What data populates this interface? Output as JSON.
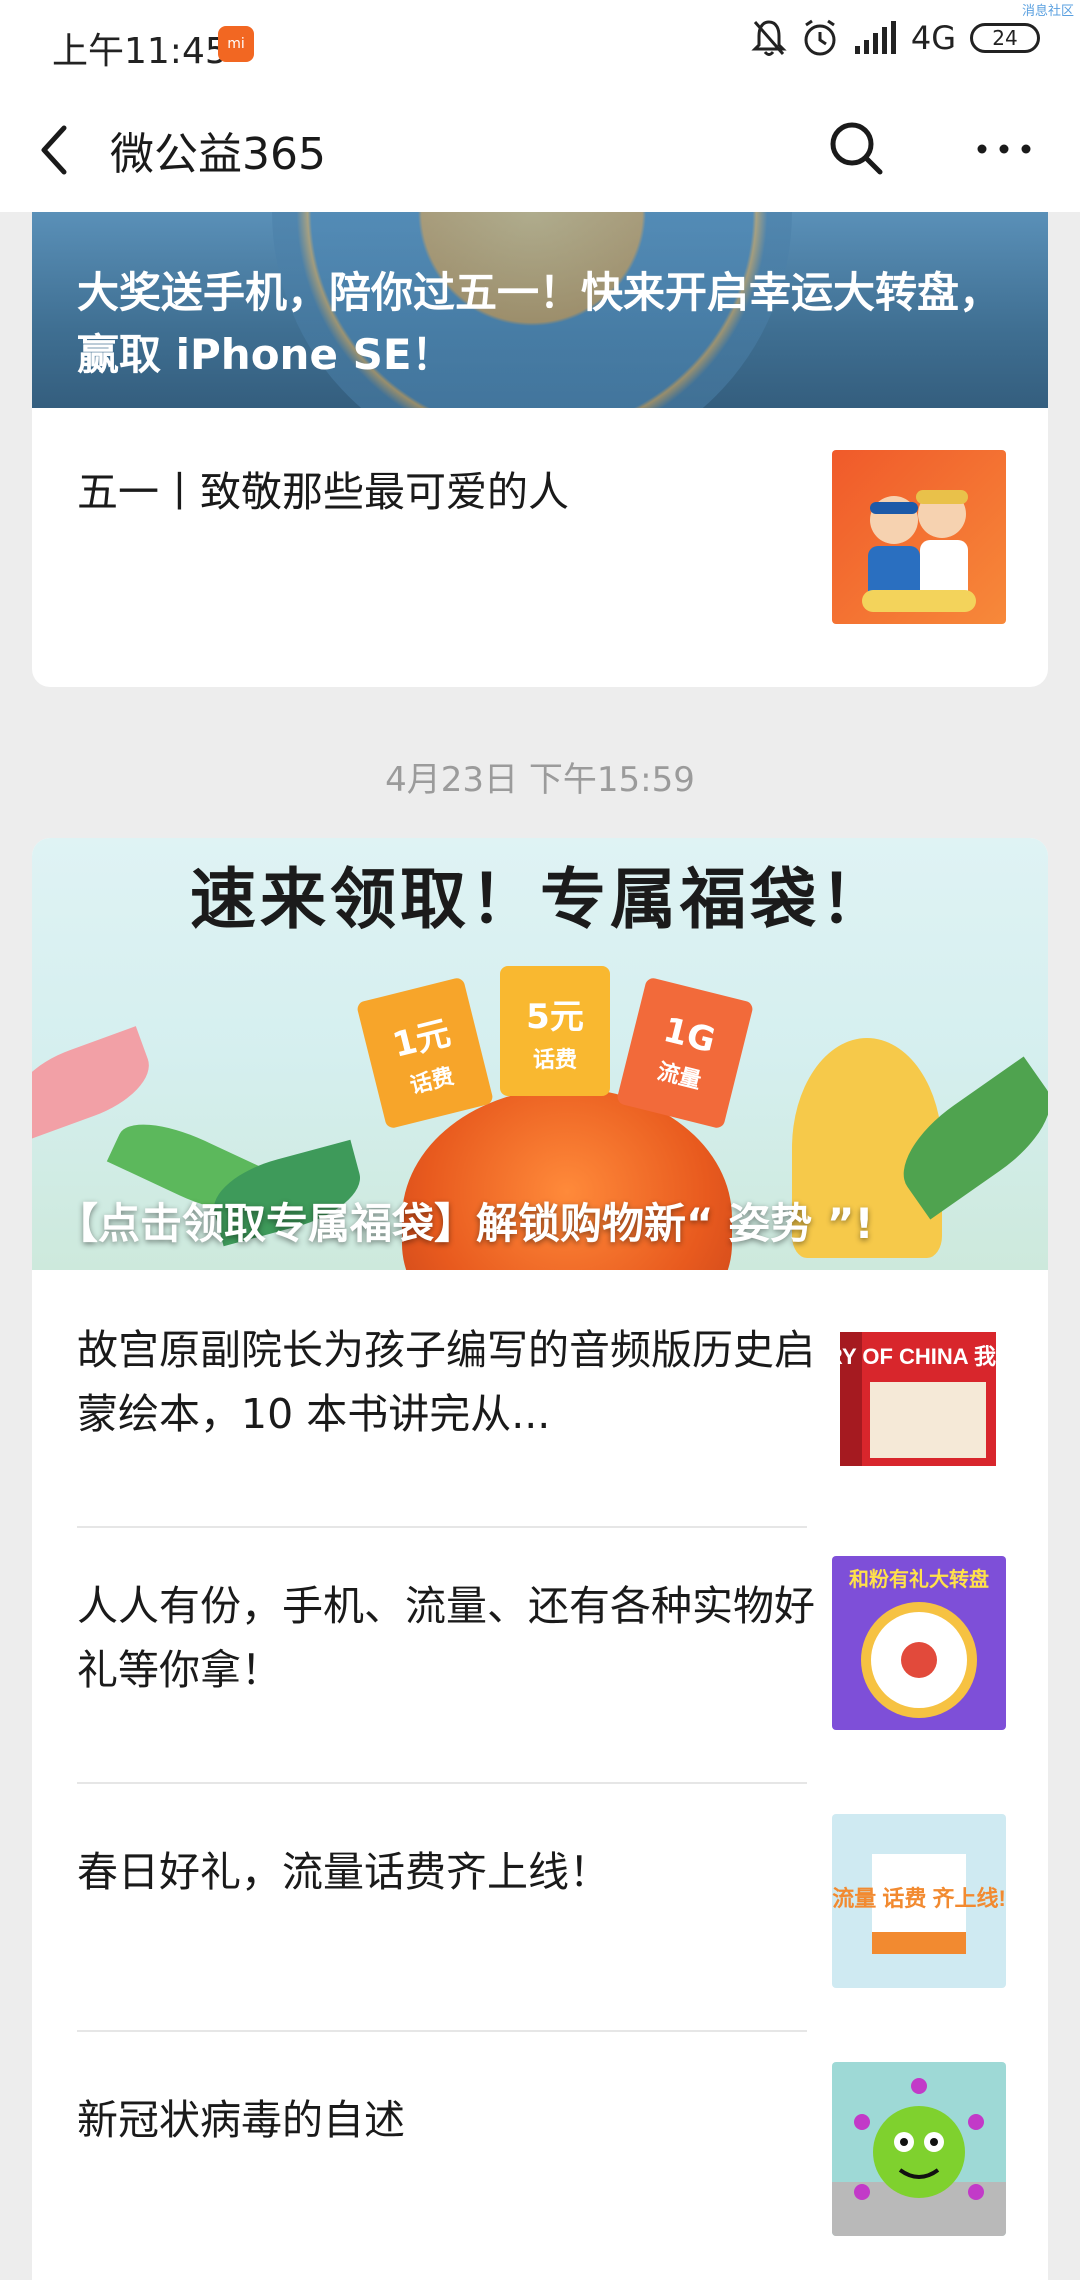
{
  "status_bar": {
    "time": "上午11:45",
    "mi_badge": "mi",
    "network": "4G",
    "battery": "24",
    "corner_tag": "消息社区",
    "icons": [
      "bell-off-icon",
      "alarm-icon",
      "signal-icon",
      "battery-icon"
    ]
  },
  "nav": {
    "title": "微公益365",
    "icons": [
      "back-icon",
      "search-icon",
      "more-icon"
    ]
  },
  "card1": {
    "banner_headline": "大奖送手机，陪你过五一！快来开启幸运大转盘，赢取 iPhone SE！",
    "articles": [
      {
        "title": "五一丨致敬那些最可爱的人"
      }
    ]
  },
  "timestamp": "4月23日 下午15:59",
  "card2": {
    "banner_title": "速来领取！专属福袋！",
    "coupons": [
      {
        "amount": "1元",
        "label": "话费"
      },
      {
        "amount": "5元",
        "label": "话费"
      },
      {
        "amount": "1G",
        "label": "流量"
      }
    ],
    "banner_caption": "【点击领取专属福袋】解锁购物新“ 姿势 ”!",
    "articles": [
      {
        "title": "故宫原副院长为孩子编写的音频版历史启蒙绘本，10 本书讲完从...",
        "thumb_text": "HISTORY OF CHINA 我们的历史"
      },
      {
        "title": "人人有份，手机、流量、还有各种实物好礼等你拿！",
        "thumb_text": "和粉有礼大转盘"
      },
      {
        "title": "春日好礼，流量话费齐上线！",
        "thumb_text": "流量 话费 齐上线!"
      },
      {
        "title": "新冠状病毒的自述",
        "thumb_text": ""
      }
    ]
  },
  "colors": {
    "background": "#ededed",
    "card": "#ffffff",
    "accent_orange": "#f26722",
    "timestamp_gray": "#9b9b9b"
  }
}
